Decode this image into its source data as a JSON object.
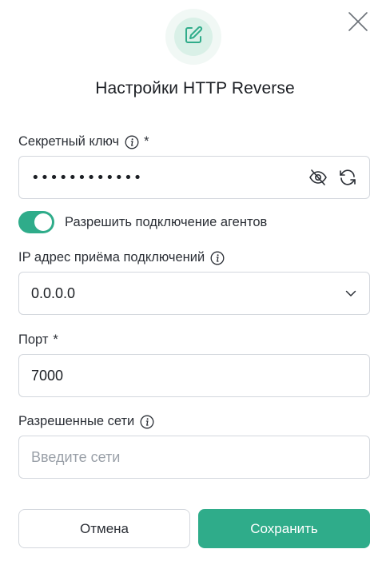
{
  "dialog": {
    "title": "Настройки HTTP Reverse",
    "header_icon": "edit-icon",
    "close_icon": "close-icon"
  },
  "secret_key": {
    "label": "Секретный ключ",
    "required_mark": "*",
    "value_masked": "••••••••••••",
    "icons": [
      "eye-off-icon",
      "refresh-icon"
    ]
  },
  "allow_agents": {
    "label": "Разрешить подключение агентов",
    "enabled": true
  },
  "ip_address": {
    "label": "IP адрес приёма подключений",
    "selected": "0.0.0.0"
  },
  "port": {
    "label": "Порт",
    "required_mark": "*",
    "value": "7000"
  },
  "allowed_networks": {
    "label": "Разрешенные сети",
    "placeholder": "Введите сети",
    "value": ""
  },
  "buttons": {
    "cancel": "Отмена",
    "save": "Сохранить"
  },
  "colors": {
    "accent": "#2fac8a",
    "border": "#d3d7dd",
    "text": "#1c1f24",
    "placeholder": "#9aa0a8"
  }
}
